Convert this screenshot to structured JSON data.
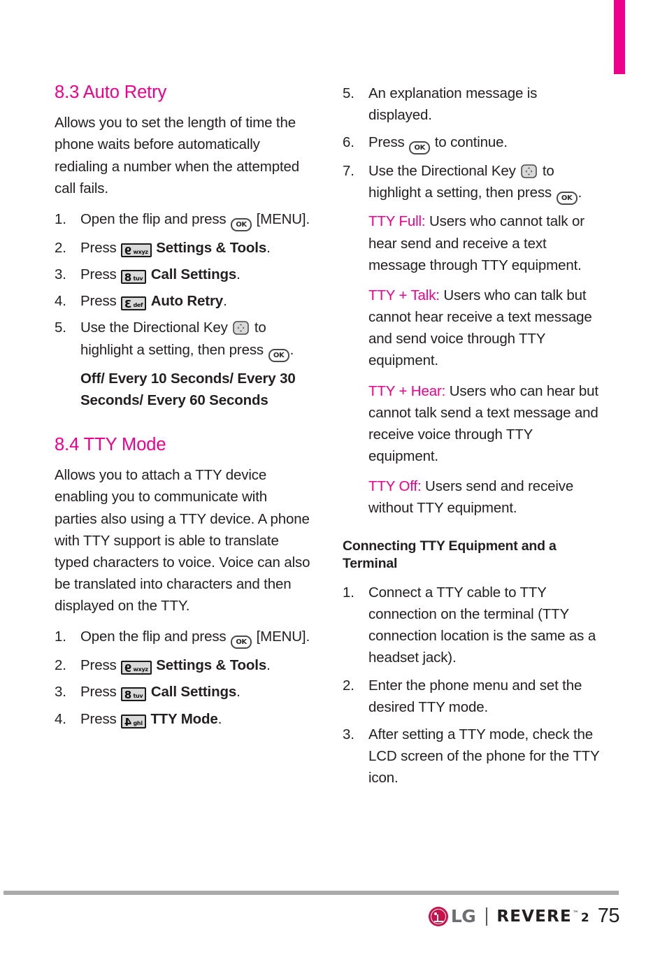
{
  "page": {
    "number": "75",
    "accent_color": "#ec008c",
    "text_color": "#231f20"
  },
  "footer": {
    "brand": "LG",
    "model": "REVERE",
    "trademark": "™",
    "model_suffix": "2",
    "page_number": "75"
  },
  "left_column": {
    "section_83": {
      "heading": "8.3 Auto Retry",
      "intro": "Allows you to set the length of time the phone waits before automatically redialing a number when the attempted call fails.",
      "steps": [
        {
          "num": "1.",
          "pre": "Open the flip and press ",
          "key": "OK",
          "post": " [MENU]."
        },
        {
          "num": "2.",
          "pre": "Press ",
          "key_digit": "9",
          "key_letters": "wxyz",
          "post_bold": "Settings & Tools",
          "post": "."
        },
        {
          "num": "3.",
          "pre": "Press ",
          "key_digit": "8",
          "key_letters": "tuv",
          "post_bold": "Call Settings",
          "post": "."
        },
        {
          "num": "4.",
          "pre": "Press ",
          "key_digit": "3",
          "key_letters": "def",
          "post_bold": "Auto Retry",
          "post": "."
        },
        {
          "num": "5.",
          "pre": "Use the Directional Key ",
          "key": "directional",
          "post": " to highlight a setting, then press ",
          "key2": "OK",
          "post2": "."
        }
      ],
      "options": "Off/ Every 10 Seconds/ Every 30 Seconds/ Every 60 Seconds"
    },
    "section_84": {
      "heading": "8.4 TTY Mode",
      "intro": "Allows you to attach a TTY device enabling you to communicate with parties also using a TTY device. A phone with TTY support is able to translate typed characters to voice. Voice can also be translated into characters and then displayed on the TTY.",
      "steps": [
        {
          "num": "1.",
          "pre": "Open the flip and press ",
          "key": "OK",
          "post": " [MENU]."
        },
        {
          "num": "2.",
          "pre": "Press ",
          "key_digit": "9",
          "key_letters": "wxyz",
          "post_bold": "Settings & Tools",
          "post": "."
        },
        {
          "num": "3.",
          "pre": "Press ",
          "key_digit": "8",
          "key_letters": "tuv",
          "post_bold": "Call Settings",
          "post": "."
        },
        {
          "num": "4.",
          "pre": "Press ",
          "key_digit": "4",
          "key_letters": "ghi",
          "post_bold": "TTY Mode",
          "post": "."
        }
      ]
    }
  },
  "right_column": {
    "steps": [
      {
        "num": "5.",
        "text": "An explanation message is displayed."
      },
      {
        "num": "6.",
        "pre": "Press ",
        "key": "OK",
        "post": " to continue."
      },
      {
        "num": "7.",
        "pre": "Use the Directional Key ",
        "key": "directional",
        "post": " to highlight a setting, then press ",
        "key2": "OK",
        "post2": "."
      }
    ],
    "definitions": [
      {
        "term": "TTY Full:",
        "description": " Users who cannot talk or hear send and receive a text message through TTY equipment."
      },
      {
        "term": "TTY + Talk:",
        "description": " Users who can talk but cannot hear receive a text message and send voice through TTY equipment."
      },
      {
        "term": "TTY + Hear:",
        "description": " Users who can hear but cannot talk send a text message and receive voice through TTY equipment."
      },
      {
        "term": "TTY Off:",
        "description": " Users send and receive without TTY equipment."
      }
    ],
    "subsection": {
      "heading": "Connecting TTY Equipment and a Terminal",
      "steps": [
        {
          "num": "1.",
          "text": "Connect a TTY cable to TTY connection on the terminal (TTY connection location is the same as a headset jack)."
        },
        {
          "num": "2.",
          "text": "Enter the phone menu and set the desired TTY mode."
        },
        {
          "num": "3.",
          "text": "After setting a TTY mode, check the LCD screen of the phone for the TTY icon."
        }
      ]
    }
  }
}
